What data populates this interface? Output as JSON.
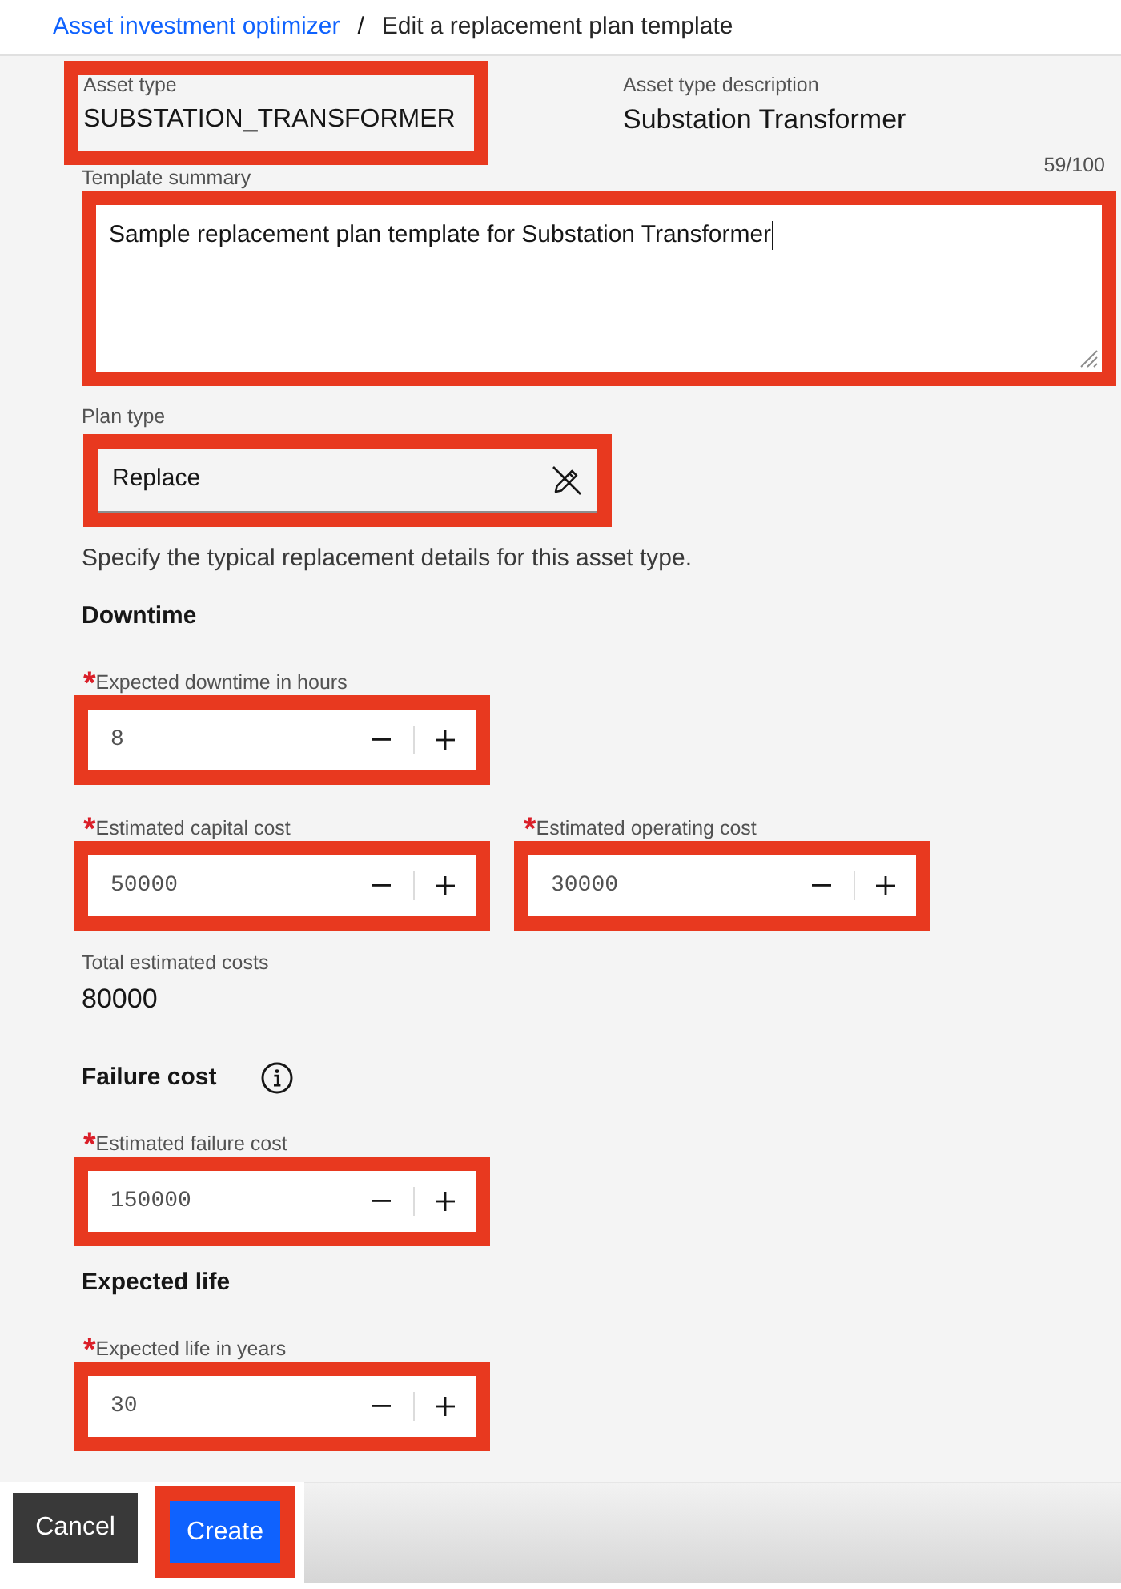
{
  "breadcrumb": {
    "items": [
      {
        "label": "Asset investment optimizer",
        "kind": "link"
      },
      {
        "label": "Edit a replacement plan template",
        "kind": "current"
      }
    ],
    "separator": "/"
  },
  "asset_type": {
    "label": "Asset type",
    "value": "SUBSTATION_TRANSFORMER",
    "highlighted": true
  },
  "asset_type_description": {
    "label": "Asset type description",
    "value": "Substation Transformer"
  },
  "template_summary": {
    "label": "Template summary",
    "counter": "59/100",
    "value": "Sample replacement plan template for Substation Transformer",
    "highlighted": true
  },
  "plan_type": {
    "label": "Plan type",
    "value": "Replace",
    "highlighted": true
  },
  "instructions": "Specify the typical replacement details for this asset type.",
  "blocks": [
    {
      "kind": "heading",
      "text": "Downtime",
      "info": false
    },
    {
      "kind": "number_row",
      "fields": [
        {
          "required_mark": "*",
          "label": "Expected downtime in hours",
          "value": "8",
          "highlighted": true
        }
      ]
    },
    {
      "kind": "number_row",
      "fields": [
        {
          "required_mark": "*",
          "label": "Estimated capital cost",
          "value": "50000",
          "highlighted": true
        },
        {
          "required_mark": "*",
          "label": "Estimated operating cost",
          "value": "30000",
          "highlighted": true
        }
      ]
    },
    {
      "kind": "readout",
      "label": "Total estimated costs",
      "value": "80000"
    },
    {
      "kind": "heading",
      "text": "Failure cost",
      "info": true
    },
    {
      "kind": "number_row",
      "fields": [
        {
          "required_mark": "*",
          "label": "Estimated failure cost",
          "value": "150000",
          "highlighted": true
        }
      ]
    },
    {
      "kind": "heading",
      "text": "Expected life",
      "info": false
    },
    {
      "kind": "number_row",
      "fields": [
        {
          "required_mark": "*",
          "label": "Expected life in years",
          "value": "30",
          "highlighted": true
        }
      ]
    }
  ],
  "footer_buttons": [
    {
      "label": "Cancel",
      "kind": "secondary",
      "highlighted": false
    },
    {
      "label": "Create",
      "kind": "primary",
      "highlighted": true
    }
  ]
}
